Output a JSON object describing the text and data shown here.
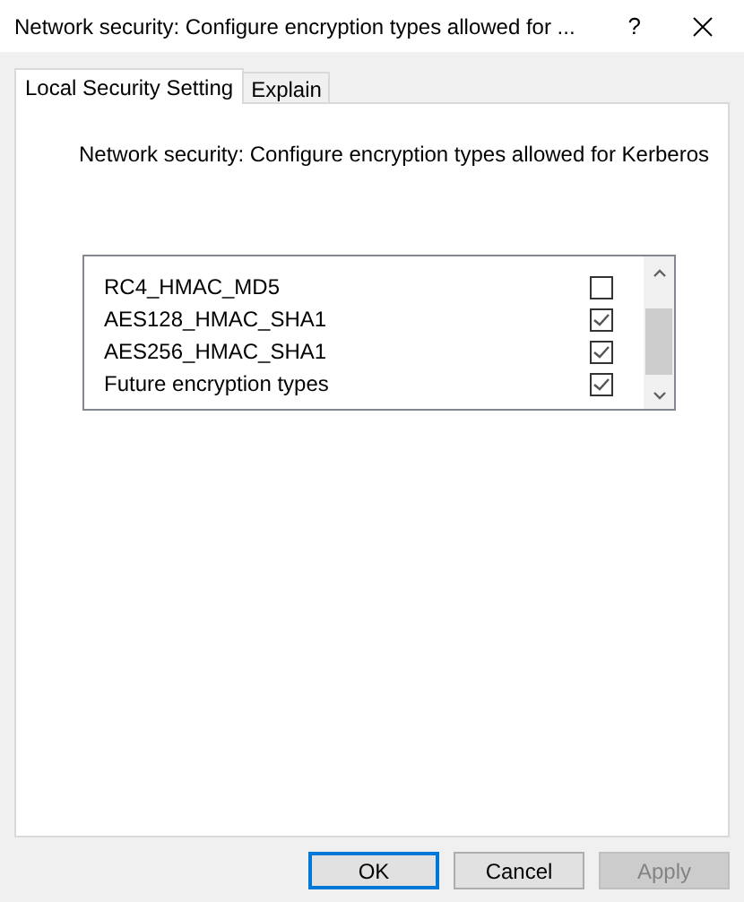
{
  "window": {
    "title": "Network security: Configure encryption types allowed for ...",
    "help": "?"
  },
  "tabs": [
    {
      "label": "Local Security Setting",
      "selected": true
    },
    {
      "label": "Explain",
      "selected": false
    }
  ],
  "policy": {
    "title": "Network security: Configure encryption types allowed for Kerberos"
  },
  "options": [
    {
      "label": "RC4_HMAC_MD5",
      "checked": false
    },
    {
      "label": "AES128_HMAC_SHA1",
      "checked": true
    },
    {
      "label": "AES256_HMAC_SHA1",
      "checked": true
    },
    {
      "label": "Future encryption types",
      "checked": true
    }
  ],
  "buttons": [
    {
      "label": "OK",
      "disabled": false,
      "default": true
    },
    {
      "label": "Cancel",
      "disabled": false,
      "default": false
    },
    {
      "label": "Apply",
      "disabled": true,
      "default": false
    }
  ]
}
